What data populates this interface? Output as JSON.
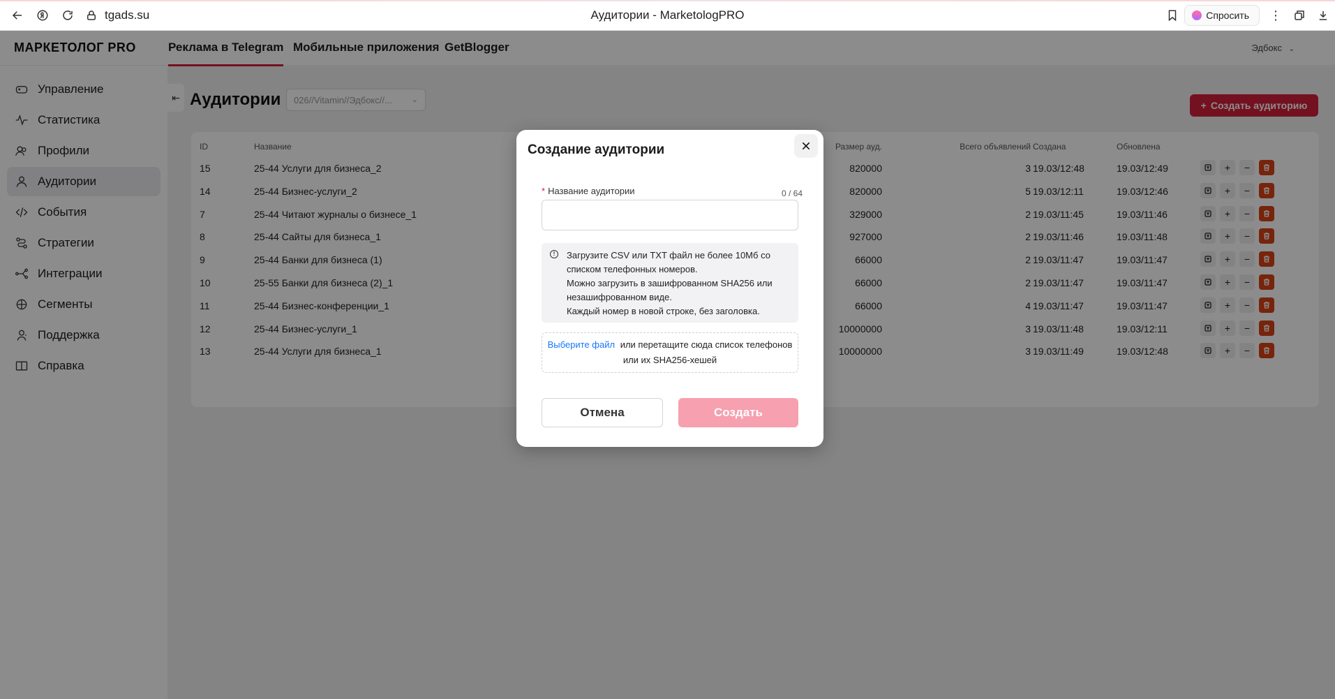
{
  "browser": {
    "url": "tgads.su",
    "page_title": "Аудитории - MarketologPRO",
    "ask_label": "Спросить"
  },
  "header": {
    "logo": "МАРКЕТОЛОГ PRO",
    "tabs": [
      {
        "label": "Реклама в Telegram",
        "active": true
      },
      {
        "label": "Мобильные приложения",
        "active": false
      },
      {
        "label": "GetBlogger",
        "active": false
      }
    ],
    "user": "Эдбокс"
  },
  "sidebar": {
    "items": [
      {
        "label": "Управление",
        "icon": "gamepad-icon",
        "active": false
      },
      {
        "label": "Статистика",
        "icon": "pulse-icon",
        "active": false
      },
      {
        "label": "Профили",
        "icon": "profiles-icon",
        "active": false
      },
      {
        "label": "Аудитории",
        "icon": "audience-icon",
        "active": true
      },
      {
        "label": "События",
        "icon": "code-icon",
        "active": false
      },
      {
        "label": "Стратегии",
        "icon": "strategy-icon",
        "active": false
      },
      {
        "label": "Интеграции",
        "icon": "integration-icon",
        "active": false
      },
      {
        "label": "Сегменты",
        "icon": "segments-icon",
        "active": false
      },
      {
        "label": "Поддержка",
        "icon": "support-icon",
        "active": false
      },
      {
        "label": "Справка",
        "icon": "book-icon",
        "active": false
      }
    ]
  },
  "main": {
    "title": "Аудитории",
    "filter_value": "026//Vitamin//Эдбокс//...",
    "create_button": "Создать аудиторию",
    "columns": {
      "id": "ID",
      "name": "Название",
      "size": "Размер ауд.",
      "total_ads": "Всего объявлений",
      "created": "Создана",
      "updated": "Обновлена"
    },
    "rows": [
      {
        "id": "15",
        "name": "25-44 Услуги для бизнеса_2",
        "size": "820000",
        "total_ads": "3",
        "created": "19.03/12:48",
        "updated": "19.03/12:49"
      },
      {
        "id": "14",
        "name": "25-44 Бизнес-услуги_2",
        "size": "820000",
        "total_ads": "5",
        "created": "19.03/12:11",
        "updated": "19.03/12:46"
      },
      {
        "id": "7",
        "name": "25-44 Читают журналы о бизнесе_1",
        "size": "329000",
        "total_ads": "2",
        "created": "19.03/11:45",
        "updated": "19.03/11:46"
      },
      {
        "id": "8",
        "name": "25-44 Сайты для бизнеса_1",
        "size": "927000",
        "total_ads": "2",
        "created": "19.03/11:46",
        "updated": "19.03/11:48"
      },
      {
        "id": "9",
        "name": "25-44 Банки для бизнеса (1)",
        "size": "66000",
        "total_ads": "2",
        "created": "19.03/11:47",
        "updated": "19.03/11:47"
      },
      {
        "id": "10",
        "name": "25-55 Банки для бизнеса (2)_1",
        "size": "66000",
        "total_ads": "2",
        "created": "19.03/11:47",
        "updated": "19.03/11:47"
      },
      {
        "id": "11",
        "name": "25-44 Бизнес-конференции_1",
        "size": "66000",
        "total_ads": "4",
        "created": "19.03/11:47",
        "updated": "19.03/11:47"
      },
      {
        "id": "12",
        "name": "25-44 Бизнес-услуги_1",
        "size": "10000000",
        "total_ads": "3",
        "created": "19.03/11:48",
        "updated": "19.03/12:11"
      },
      {
        "id": "13",
        "name": "25-44 Услуги для бизнеса_1",
        "size": "10000000",
        "total_ads": "3",
        "created": "19.03/11:49",
        "updated": "19.03/12:48"
      }
    ]
  },
  "modal": {
    "title": "Создание аудитории",
    "field_label": "Название аудитории",
    "required_mark": "*",
    "counter": "0 / 64",
    "input_value": "",
    "info_lines": [
      "Загрузите CSV или TXT файл не более 10Мб со списком телефонных номеров.",
      "Можно загрузить в зашифрованном SHA256 или незашифрованном виде.",
      "Каждый номер в новой строке, без заголовка."
    ],
    "drop_link": "Выберите файл",
    "drop_text": "или перетащите сюда список телефонов или их SHA256-хешей",
    "cancel_label": "Отмена",
    "submit_label": "Создать"
  },
  "colors": {
    "accent": "#d31f3b",
    "submit_disabled": "#f7a0af",
    "delete": "#d84315",
    "link": "#1677ff"
  }
}
